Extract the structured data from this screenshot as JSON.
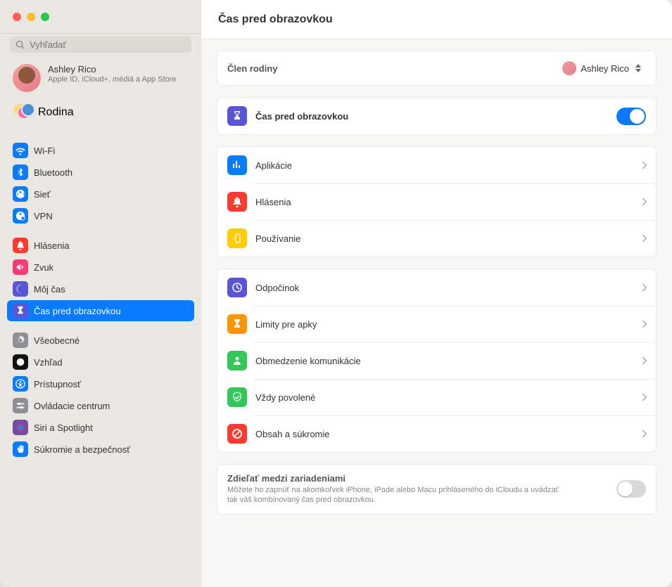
{
  "header": {
    "title": "Čas pred obrazovkou"
  },
  "search": {
    "placeholder": "Vyhľadať"
  },
  "profile": {
    "name": "Ashley Rico",
    "sub": "Apple ID, iCloud+, médiá a App Store"
  },
  "family": {
    "label": "Rodina"
  },
  "sidebar": {
    "items": [
      {
        "label": "Wi-Fi",
        "bg": "#0a7aff",
        "icon": "wifi"
      },
      {
        "label": "Bluetooth",
        "bg": "#0a7aff",
        "icon": "bluetooth"
      },
      {
        "label": "Sieť",
        "bg": "#0a7aff",
        "icon": "globe"
      },
      {
        "label": "VPN",
        "bg": "#0a7aff",
        "icon": "globe-badge"
      }
    ],
    "items2": [
      {
        "label": "Hlásenia",
        "bg": "#ff3b30",
        "icon": "bell"
      },
      {
        "label": "Zvuk",
        "bg": "#ff3b77",
        "icon": "speaker"
      },
      {
        "label": "Môj čas",
        "bg": "#5856d6",
        "icon": "moon"
      },
      {
        "label": "Čas pred obrazovkou",
        "bg": "#5856d6",
        "icon": "hourglass",
        "selected": true
      }
    ],
    "items3": [
      {
        "label": "Všeobecné",
        "bg": "#8e8e93",
        "icon": "gear"
      },
      {
        "label": "Vzhľad",
        "bg": "#111111",
        "icon": "appearance"
      },
      {
        "label": "Prístupnosť",
        "bg": "#0a7aff",
        "icon": "accessibility"
      },
      {
        "label": "Ovládacie centrum",
        "bg": "#8e8e93",
        "icon": "sliders"
      },
      {
        "label": "Siri a Spotlight",
        "bg": "#764ba2",
        "icon": "siri"
      },
      {
        "label": "Súkromie a bezpečnosť",
        "bg": "#0a7aff",
        "icon": "hand"
      }
    ]
  },
  "familyCard": {
    "label": "Člen rodiny",
    "memberName": "Ashley Rico"
  },
  "screenTimeToggle": {
    "label": "Čas pred obrazovkou",
    "bg": "#5856d6",
    "icon": "hourglass"
  },
  "usage": [
    {
      "label": "Aplikácie",
      "bg": "#0a7aff",
      "icon": "chart"
    },
    {
      "label": "Hlásenia",
      "bg": "#ff3b30",
      "icon": "bell"
    },
    {
      "label": "Používanie",
      "bg": "#ffcc00",
      "icon": "pickups"
    }
  ],
  "limits": [
    {
      "label": "Odpočinok",
      "bg": "#5856d6",
      "icon": "downtime"
    },
    {
      "label": "Limity pre apky",
      "bg": "#ff9500",
      "icon": "hourglass"
    },
    {
      "label": "Obmedzenie komunikácie",
      "bg": "#34c759",
      "icon": "person"
    },
    {
      "label": "Vždy povolené",
      "bg": "#34c759",
      "icon": "check-shield"
    },
    {
      "label": "Obsah a súkromie",
      "bg": "#ff3b30",
      "icon": "nosign"
    }
  ],
  "share": {
    "title": "Zdieľať medzi zariadeniami",
    "sub": "Môžete ho zapnúť na akomkoľvek iPhone, iPade alebo Macu prihláseného do iCloudu a uvádzať tak váš kombinovaný čas pred obrazovkou."
  }
}
